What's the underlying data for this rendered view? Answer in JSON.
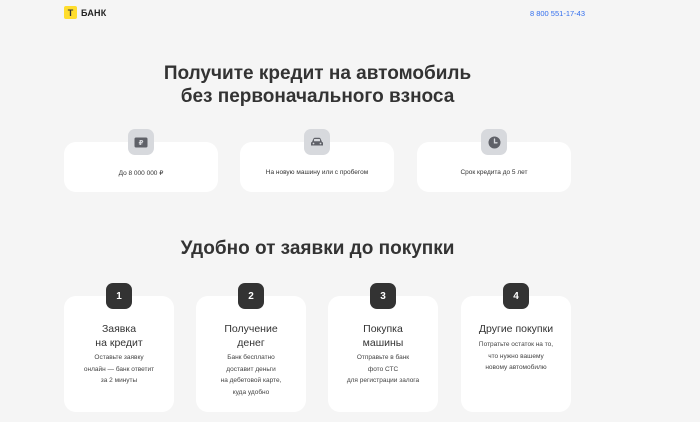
{
  "header": {
    "logo_mark": "Т",
    "logo_text": "БАНК",
    "phone": "8 800 551-17-43"
  },
  "hero": {
    "title_line1": "Получите кредит на автомобиль",
    "title_line2": "без первоначального взноса"
  },
  "features": [
    {
      "icon": "ruble-card-icon",
      "text": "До 8 000 000 ₽"
    },
    {
      "icon": "car-icon",
      "text": "На новую машину или с пробегом"
    },
    {
      "icon": "clock-icon",
      "text": "Срок кредита до 5 лет"
    }
  ],
  "steps_section": {
    "title": "Удобно от заявки до покупки",
    "steps": [
      {
        "number": "1",
        "title": "Заявка\nна кредит",
        "description": "Оставьте заявку\nонлайн — банк ответит\nза 2 минуты"
      },
      {
        "number": "2",
        "title": "Получение\nденег",
        "description": "Банк бесплатно\nдоставит деньги\nна дебетовой карте,\nкуда удобно"
      },
      {
        "number": "3",
        "title": "Покупка\nмашины",
        "description": "Отправьте в банк\nфото СТС\nдля регистрации залога"
      },
      {
        "number": "4",
        "title": "Другие покупки",
        "description": "Потратьте остаток на то,\nчто нужно вашему\nновому автомобилю"
      }
    ]
  }
}
